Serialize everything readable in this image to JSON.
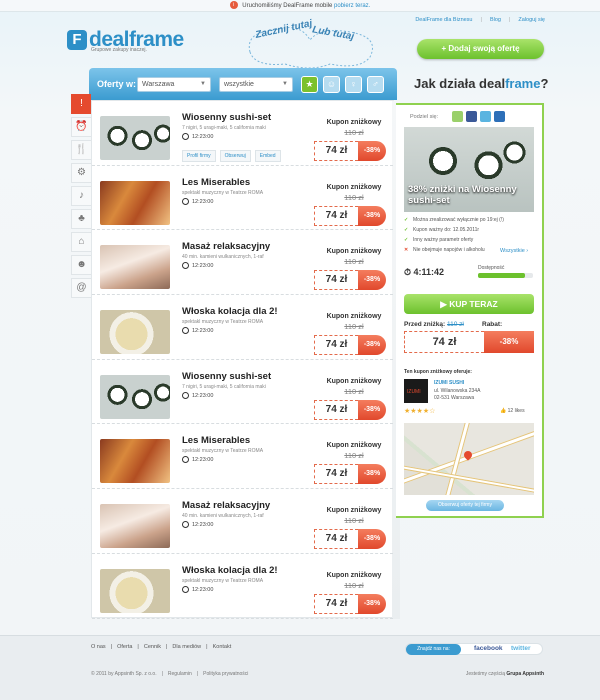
{
  "announce": {
    "text": "Uruchomiliśmy DealFrame mobile",
    "link": "pobierz teraz."
  },
  "toplinks": [
    "DealFrame dla Biznesu",
    "Blog",
    "Zaloguj się"
  ],
  "logo": {
    "icon": "F",
    "name": "dealframe",
    "tagline": "Grupowe zakupy inaczej."
  },
  "doodle": {
    "a": "Zacznij tutaj",
    "b": "Lub tutaj"
  },
  "add_offer": "Dodaj swoją ofertę",
  "filter": {
    "label": "Oferty w:",
    "city": "Warszawa",
    "category": "wszystkie",
    "icons": [
      "star-icon",
      "face-icon",
      "female-icon",
      "male-icon"
    ]
  },
  "side_icons": [
    "alert-icon",
    "alarm-icon",
    "food-icon",
    "gear-icon",
    "music-icon",
    "tree-icon",
    "home-icon",
    "person-icon",
    "at-icon"
  ],
  "coupon_label": "Kupon zniżkowy",
  "actions": [
    "Profil firmy",
    "Obserwuj",
    "Embed"
  ],
  "offers": [
    {
      "title": "Wiosenny sushi-set",
      "sub": "7 nigiri, 5 uragi-maki, 5 california maki",
      "time": "12:23:00",
      "old": "110 zł",
      "price": "74 zł",
      "discount": "-38%",
      "img": "sushi"
    },
    {
      "title": "Les Miserables",
      "sub": "spektakl muzyczny w Teatrze ROMA",
      "time": "12:23:00",
      "old": "110 zł",
      "price": "74 zł",
      "discount": "-38%",
      "img": "crowd"
    },
    {
      "title": "Masaż relaksacyjny",
      "sub": "40 min. kamieni wulkanicznych, 1-raf",
      "time": "12:23:00",
      "old": "110 zł",
      "price": "74 zł",
      "discount": "-38%",
      "img": "spa"
    },
    {
      "title": "Włoska kolacja dla 2!",
      "sub": "spektakl muzyczny w Teatrze ROMA",
      "time": "12:23:00",
      "old": "110 zł",
      "price": "74 zł",
      "discount": "-38%",
      "img": "pasta"
    },
    {
      "title": "Wiosenny sushi-set",
      "sub": "7 nigiri, 5 uragi-maki, 5 california maki",
      "time": "12:23:00",
      "old": "110 zł",
      "price": "74 zł",
      "discount": "-38%",
      "img": "sushi"
    },
    {
      "title": "Les Miserables",
      "sub": "spektakl muzyczny w Teatrze ROMA",
      "time": "12:23:00",
      "old": "110 zł",
      "price": "74 zł",
      "discount": "-38%",
      "img": "crowd"
    },
    {
      "title": "Masaż relaksacyjny",
      "sub": "40 min. kamieni wulkanicznych, 1-raf",
      "time": "12:23:00",
      "old": "110 zł",
      "price": "74 zł",
      "discount": "-38%",
      "img": "spa"
    },
    {
      "title": "Włoska kolacja dla 2!",
      "sub": "spektakl muzyczny w Teatrze ROMA",
      "time": "12:23:00",
      "old": "110 zł",
      "price": "74 zł",
      "discount": "-38%",
      "img": "pasta"
    }
  ],
  "how": {
    "a": "Jak działa deal",
    "b": "frame",
    "c": "?"
  },
  "panel": {
    "share": "Podziel się:",
    "caption": "38% zniżki na Wiosenny sushi-set",
    "conditions": [
      {
        "ok": true,
        "text": "Można zrealizować wyłącznie po 19:ej (!)"
      },
      {
        "ok": true,
        "text": "Kupon ważny do: 12.05.2011r"
      },
      {
        "ok": true,
        "text": "Inny ważny parametr oferty"
      },
      {
        "ok": false,
        "text": "Nie obejmuje napojów i alkoholu"
      }
    ],
    "more": "Wszystkie",
    "timer": "4:11:42",
    "avail_label": "Dostępność",
    "avail_level": 0.85,
    "buy": "KUP TERAZ",
    "before_label": "Przed zniżką:",
    "before": "110 zł",
    "rebate_label": "Rabat:",
    "price": "74 zł",
    "discount": "-38%",
    "offer_by": "Ten kupon zniżkowy oferuje:",
    "shop_logo": "IZUMI",
    "shop": "IZUMI SUSHI",
    "addr1": "ul. Wilanowska 234A",
    "addr2": "02-531 Warszawa",
    "stars": "★★★★☆",
    "rating": 4,
    "likes": "12 likes",
    "see_all": "Obserwuj oferty tej firmy"
  },
  "footer": {
    "links": [
      "O nas",
      "Oferta",
      "Cennik",
      "Dla mediów",
      "Kontakt"
    ],
    "copy": "© 2011 by Appsinth Sp. z o.o.",
    "legal": [
      "Regulamin",
      "Polityka prywatności"
    ],
    "find": "Znajdź nas na:",
    "fb": "facebook",
    "tw": "twitter",
    "part": "Jesteśmy częścią",
    "group": "Grupa Appsinth"
  }
}
